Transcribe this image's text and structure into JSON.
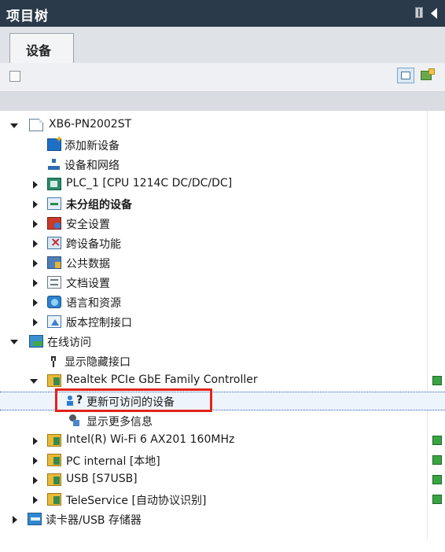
{
  "window": {
    "title": "项目树"
  },
  "tabs": [
    {
      "label": "设备"
    }
  ],
  "colors": {
    "accent": "#2b3a4a",
    "highlight_box": "#e2231a",
    "status_green": "#3aa344"
  },
  "tree": {
    "root": {
      "label": "XB6-PN2002ST"
    },
    "items": [
      {
        "label": "添加新设备",
        "icon": "add-device-icon"
      },
      {
        "label": "设备和网络",
        "icon": "network-icon"
      },
      {
        "label": "PLC_1 [CPU 1214C DC/DC/DC]",
        "icon": "plc-icon"
      },
      {
        "label": "未分组的设备",
        "icon": "ungrouped-devices-icon",
        "bold": true
      },
      {
        "label": "安全设置",
        "icon": "security-icon"
      },
      {
        "label": "跨设备功能",
        "icon": "cross-device-icon"
      },
      {
        "label": "公共数据",
        "icon": "common-data-icon"
      },
      {
        "label": "文档设置",
        "icon": "document-settings-icon"
      },
      {
        "label": "语言和资源",
        "icon": "languages-icon"
      },
      {
        "label": "版本控制接口",
        "icon": "version-control-icon"
      }
    ],
    "online_access": {
      "label": "在线访问",
      "children": [
        {
          "label": "显示隐藏接口",
          "icon": "plug-icon"
        },
        {
          "label": "Realtek PCIe GbE Family Controller",
          "icon": "adapter-folder-icon",
          "children": [
            {
              "label": "更新可访问的设备",
              "icon": "refresh-devices-icon",
              "selected": true
            },
            {
              "label": "显示更多信息",
              "icon": "more-info-icon"
            }
          ]
        },
        {
          "label": "Intel(R) Wi-Fi 6 AX201 160MHz",
          "icon": "adapter-folder-icon"
        },
        {
          "label": "PC internal [本地]",
          "icon": "adapter-folder-icon"
        },
        {
          "label": "USB [S7USB]",
          "icon": "adapter-folder-icon"
        },
        {
          "label": "TeleService [自动协议识别]",
          "icon": "adapter-folder-icon"
        }
      ]
    },
    "card_reader": {
      "label": "读卡器/USB 存储器",
      "icon": "card-reader-icon"
    }
  }
}
